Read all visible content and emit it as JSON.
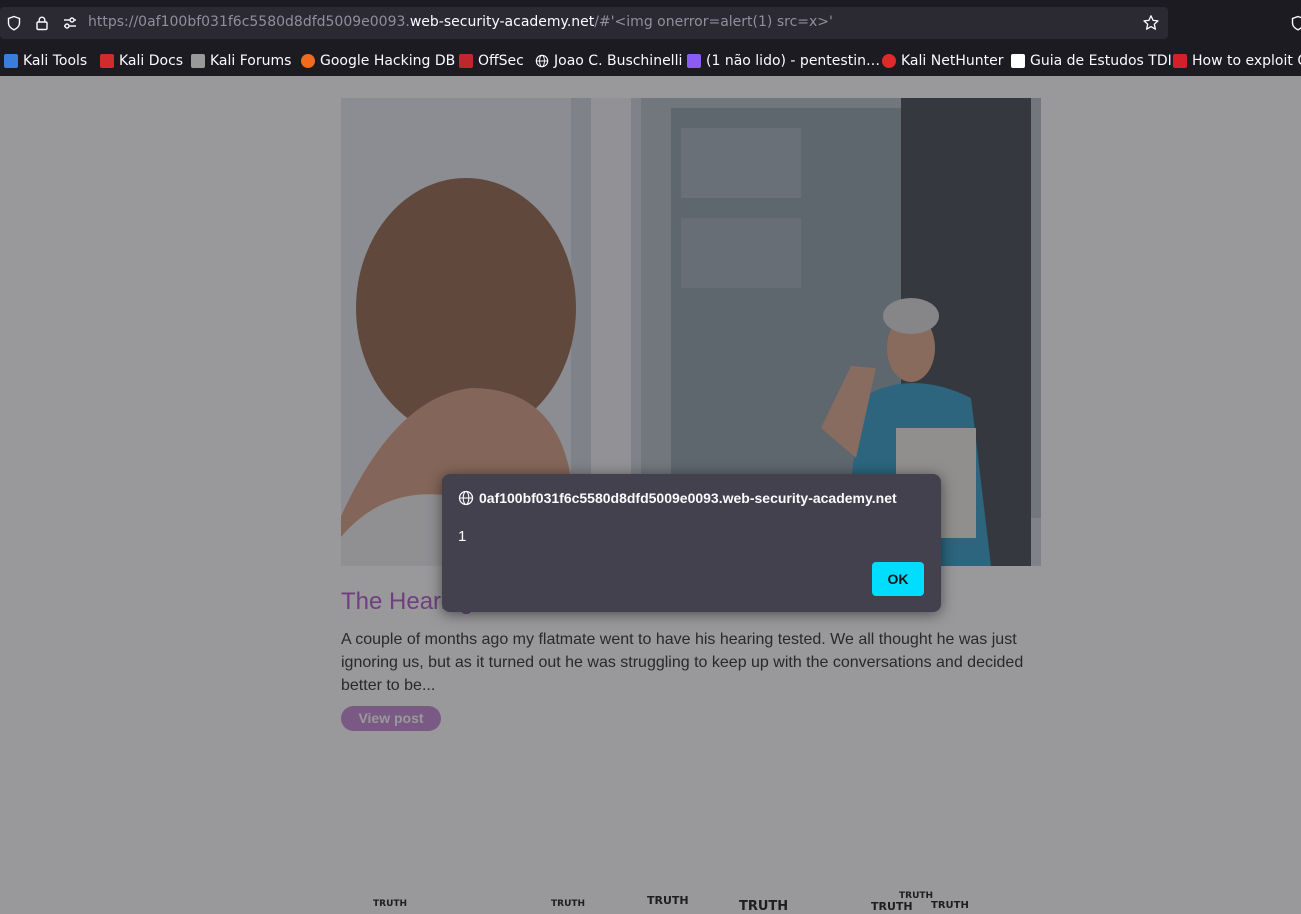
{
  "browser": {
    "url_prefix": "https://0af100bf031f6c5580d8dfd5009e0093.",
    "url_host": "web-security-academy.net",
    "url_suffix": "/#'<img onerror=alert(1) src=x>'",
    "bookmarks": [
      {
        "label": "Kali Tools",
        "color": "#3b7ddd"
      },
      {
        "label": "Kali Docs",
        "color": "#d12b2b"
      },
      {
        "label": "Kali Forums",
        "color": "#dddddd"
      },
      {
        "label": "Google Hacking DB",
        "color": "#f26a1b"
      },
      {
        "label": "OffSec",
        "color": "#c0262d"
      },
      {
        "label": "Joao C. Buschinelli",
        "color": "#fbfbfe"
      },
      {
        "label": "(1 não lido) - pentestin…",
        "color": "#8a5cf5"
      },
      {
        "label": "Kali NetHunter",
        "color": "#e02a2a"
      },
      {
        "label": "Guia de Estudos TDI",
        "color": "#ffffff"
      },
      {
        "label": "How to exploit C",
        "color": "#d4202a"
      }
    ]
  },
  "post": {
    "title": "The Hearing",
    "excerpt": "A couple of months ago my flatmate went to have his hearing tested. We all thought he was just ignoring us, but as it turned out he was struggling to keep up with the conversations and decided better to be...",
    "view_button": "View post"
  },
  "truth_words": "TRUTH",
  "dialog": {
    "origin": "0af100bf031f6c5580d8dfd5009e0093.web-security-academy.net",
    "message": "1",
    "ok_label": "OK",
    "ok_color": "#00ddff"
  }
}
